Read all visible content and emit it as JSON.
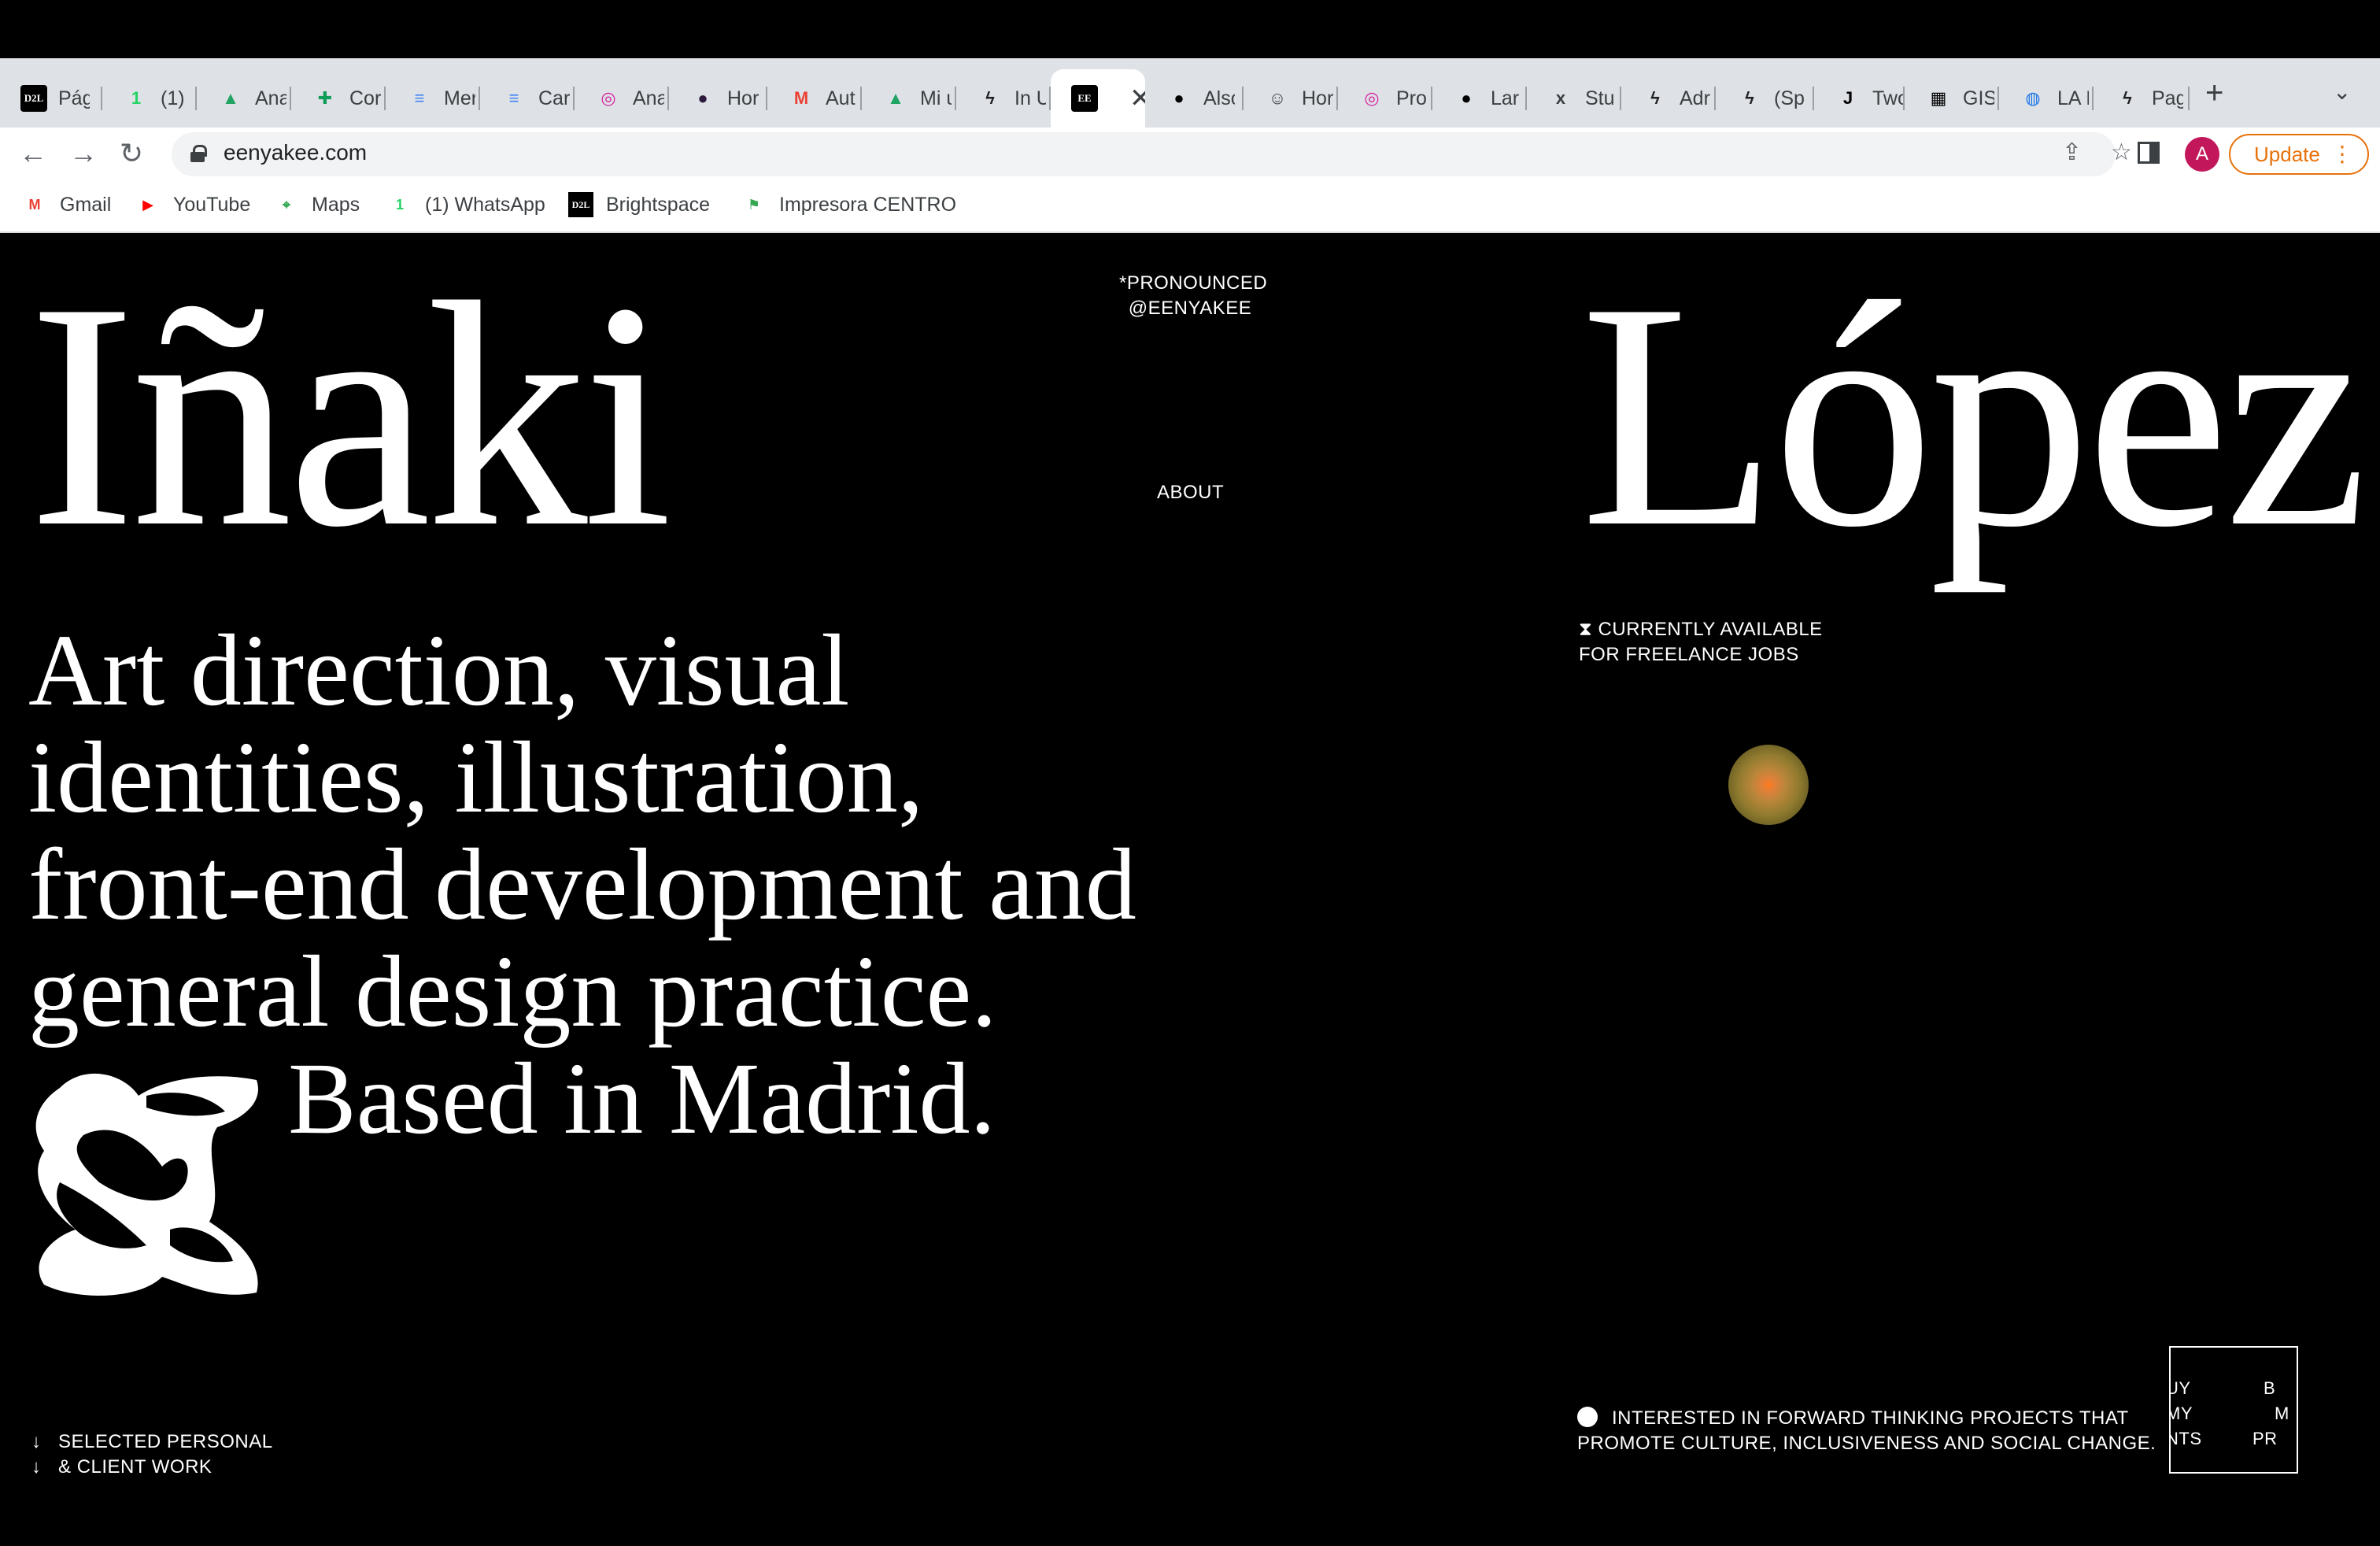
{
  "browser": {
    "tabs": [
      {
        "favicon": "D2L",
        "label": "Pág",
        "icon": "d2l-icon",
        "color": "#000000"
      },
      {
        "favicon": "1",
        "label": "(1)",
        "icon": "whatsapp-icon",
        "color": "#25d366"
      },
      {
        "favicon": "▲",
        "label": "Ana",
        "icon": "google-drive-icon",
        "color": "#1fa463"
      },
      {
        "favicon": "✚",
        "label": "Cor",
        "icon": "google-sheets-icon",
        "color": "#0f9d58"
      },
      {
        "favicon": "≡",
        "label": "Mer",
        "icon": "google-docs-icon",
        "color": "#4285f4"
      },
      {
        "favicon": "≡",
        "label": "Car",
        "icon": "google-docs-icon",
        "color": "#4285f4"
      },
      {
        "favicon": "◎",
        "label": "Ana",
        "icon": "instagram-icon",
        "color": "#d6249f"
      },
      {
        "favicon": "●",
        "label": "Hor",
        "icon": "circle-icon",
        "color": "#2d1b3d"
      },
      {
        "favicon": "M",
        "label": "Aut",
        "icon": "gmail-icon",
        "color": "#ea4335"
      },
      {
        "favicon": "▲",
        "label": "Mi u",
        "icon": "google-drive-icon",
        "color": "#1fa463"
      },
      {
        "favicon": "ϟ",
        "label": "In U",
        "icon": "bolt-icon",
        "color": "#202124"
      },
      {
        "favicon": "EE",
        "label": "",
        "icon": "eenyakee-icon",
        "color": "#000000",
        "active": true
      },
      {
        "favicon": "●",
        "label": "Also",
        "icon": "circle-icon",
        "color": "#000000"
      },
      {
        "favicon": "☺",
        "label": "Hor",
        "icon": "smiley-icon",
        "color": "#3c4043"
      },
      {
        "favicon": "◎",
        "label": "Pro",
        "icon": "instagram-icon",
        "color": "#d6249f"
      },
      {
        "favicon": "●",
        "label": "Lar",
        "icon": "circle-icon",
        "color": "#000000"
      },
      {
        "favicon": "x",
        "label": "Stu",
        "icon": "x-icon",
        "color": "#3c4043"
      },
      {
        "favicon": "ϟ",
        "label": "Adr",
        "icon": "bolt-icon",
        "color": "#202124"
      },
      {
        "favicon": "ϟ",
        "label": "(Sp",
        "icon": "bolt-icon",
        "color": "#202124"
      },
      {
        "favicon": "J",
        "label": "Two",
        "icon": "j-icon",
        "color": "#000000"
      },
      {
        "favicon": "▦",
        "label": "GIS",
        "icon": "gis-icon",
        "color": "#000000"
      },
      {
        "favicon": "◍",
        "label": "LA I",
        "icon": "globe-icon",
        "color": "#1a73e8"
      },
      {
        "favicon": "ϟ",
        "label": "Pag",
        "icon": "bolt-icon",
        "color": "#202124"
      }
    ],
    "close_glyph": "✕",
    "new_tab_glyph": "+",
    "tab_menu_glyph": "⌄",
    "url": "eenyakee.com",
    "avatar_letter": "A",
    "update_label": "Update",
    "bookmarks": [
      {
        "label": "Gmail",
        "favicon": "M",
        "icon": "gmail-icon",
        "color": "#ea4335"
      },
      {
        "label": "YouTube",
        "favicon": "▶",
        "icon": "youtube-icon",
        "color": "#ff0000"
      },
      {
        "label": "Maps",
        "favicon": "⌖",
        "icon": "google-maps-icon",
        "color": "#34a853"
      },
      {
        "label": "(1) WhatsApp",
        "favicon": "1",
        "icon": "whatsapp-icon",
        "color": "#25d366"
      },
      {
        "label": "Brightspace",
        "favicon": "D2L",
        "icon": "d2l-icon",
        "color": "#000000"
      },
      {
        "label": "Impresora CENTRO",
        "favicon": "⚑",
        "icon": "printer-flag-icon",
        "color": "#34a853"
      }
    ]
  },
  "page": {
    "first_name": "Iñaki",
    "last_name": "López",
    "pronounced_line1": "*PRONOUNCED",
    "pronounced_line2": "@EENYAKEE",
    "about_link": "ABOUT",
    "availability_line1": "CURRENTLY AVAILABLE",
    "availability_line2": "FOR FREELANCE JOBS",
    "tagline": [
      "Art direction, visual",
      "identities, illustration,",
      "front-end development and",
      "general design practice.",
      "Based in Madrid."
    ],
    "work_link_line1": "SELECTED PERSONAL",
    "work_link_line2": "& CLIENT WORK",
    "interest_line1": "INTERESTED IN FORWARD THINKING PROJECTS THAT",
    "interest_line2": "PROMOTE CULTURE, INCLUSIVENESS AND SOCIAL CHANGE.",
    "print_col1": [
      "UY",
      "MY",
      "NTS"
    ],
    "print_col2": [
      "B",
      "M",
      "PR"
    ],
    "orb_color": "#ff7a1a"
  }
}
